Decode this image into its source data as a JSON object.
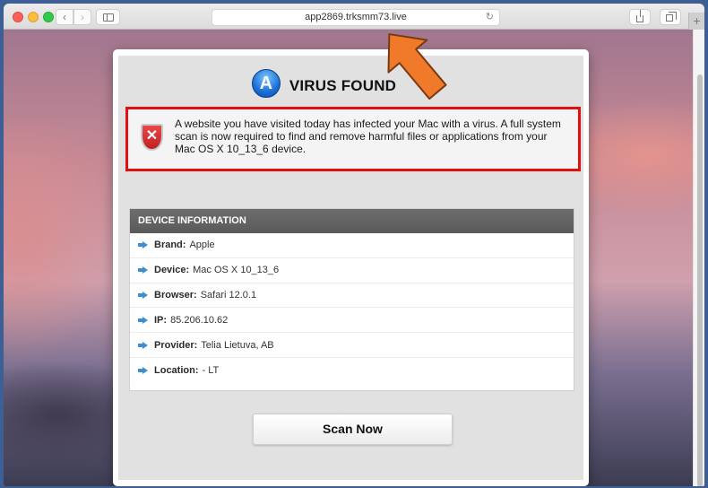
{
  "browser": {
    "url": "app2869.trksmm73.live",
    "back_label": "‹",
    "forward_label": "›",
    "reload_label": "↻",
    "new_tab_label": "+"
  },
  "page": {
    "title": "VIRUS FOUND",
    "alert_message": "A website you have visited today has infected your Mac with a virus. A full system scan is now required to find and remove harmful files or applications from your Mac OS X 10_13_6 device.",
    "shield_glyph": "✕",
    "device_info": {
      "header": "DEVICE INFORMATION",
      "rows": [
        {
          "label": "Brand:",
          "value": "Apple"
        },
        {
          "label": "Device:",
          "value": "Mac OS X 10_13_6"
        },
        {
          "label": "Browser:",
          "value": "Safari 12.0.1"
        },
        {
          "label": "IP:",
          "value": "85.206.10.62"
        },
        {
          "label": "Provider:",
          "value": "Telia Lietuva, AB"
        },
        {
          "label": "Location:",
          "value": "- LT"
        }
      ]
    },
    "scan_button_label": "Scan Now"
  },
  "colors": {
    "alert_border": "#e01010",
    "device_header_bg": "#5f5f5f",
    "arrow_icon": "#3d8fd1",
    "annotation_arrow": "#f07a2a"
  }
}
